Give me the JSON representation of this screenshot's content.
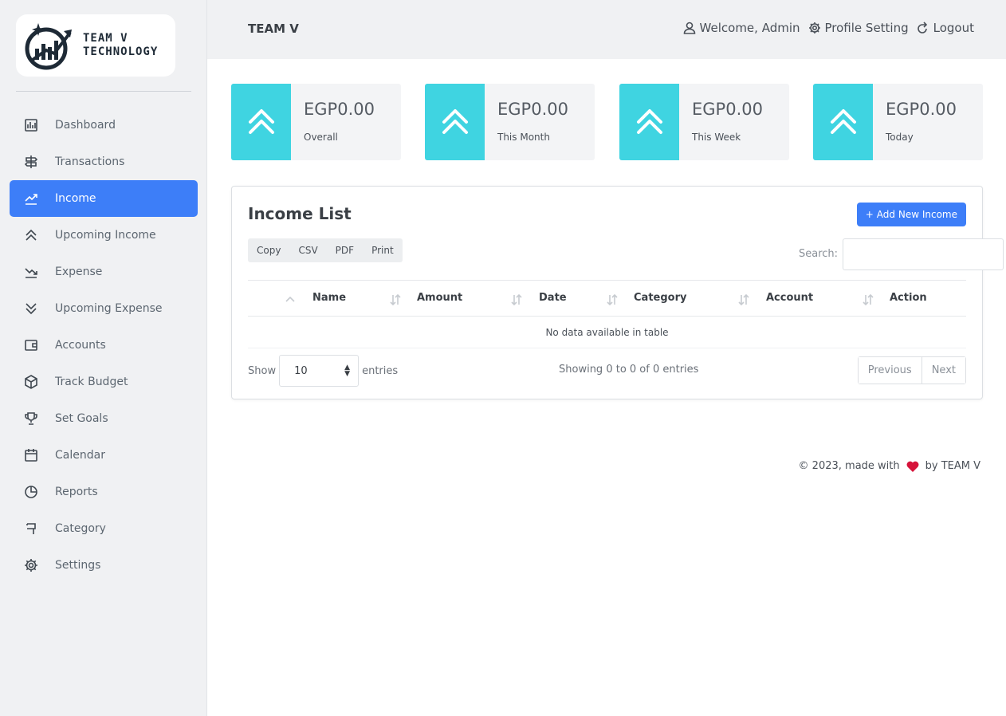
{
  "logo": {
    "line1": "TEAM V",
    "line2": "TECHNOLOGY"
  },
  "sidebar": {
    "items": [
      {
        "label": "Dashboard",
        "icon": "dashboard-icon"
      },
      {
        "label": "Transactions",
        "icon": "signpost-icon"
      },
      {
        "label": "Income",
        "icon": "trend-up-icon",
        "active": true
      },
      {
        "label": "Upcoming Income",
        "icon": "chevrons-up-icon"
      },
      {
        "label": "Expense",
        "icon": "trend-down-icon"
      },
      {
        "label": "Upcoming Expense",
        "icon": "chevrons-down-icon"
      },
      {
        "label": "Accounts",
        "icon": "wallet-icon"
      },
      {
        "label": "Track Budget",
        "icon": "box-icon"
      },
      {
        "label": "Set Goals",
        "icon": "trophy-icon"
      },
      {
        "label": "Calendar",
        "icon": "calendar-icon"
      },
      {
        "label": "Reports",
        "icon": "pie-chart-icon"
      },
      {
        "label": "Category",
        "icon": "flag-icon"
      },
      {
        "label": "Settings",
        "icon": "gear-icon"
      }
    ]
  },
  "header": {
    "brand": "TEAM V",
    "welcome": "Welcome, Admin",
    "profile": "Profile Setting",
    "logout": "Logout"
  },
  "stats": [
    {
      "value": "EGP0.00",
      "label": "Overall"
    },
    {
      "value": "EGP0.00",
      "label": "This Month"
    },
    {
      "value": "EGP0.00",
      "label": "This Week"
    },
    {
      "value": "EGP0.00",
      "label": "Today"
    }
  ],
  "income_list": {
    "title": "Income List",
    "add_button": "Add New Income",
    "export_buttons": [
      "Copy",
      "CSV",
      "PDF",
      "Print"
    ],
    "search_label": "Search:",
    "columns": [
      "Name",
      "Amount",
      "Date",
      "Category",
      "Account",
      "Action"
    ],
    "empty_message": "No data available in table",
    "show_label": "Show",
    "entries_value": "10",
    "entries_label": "entries",
    "info": "Showing 0 to 0 of 0 entries",
    "previous": "Previous",
    "next": "Next"
  },
  "footer": {
    "prefix": "© 2023, made with",
    "suffix": "by TEAM V"
  },
  "colors": {
    "accent": "#3d7ef8",
    "stat_icon_bg": "#3fd4e1",
    "heart": "#d6133a",
    "sidebar_bg": "#f0f1f3"
  }
}
